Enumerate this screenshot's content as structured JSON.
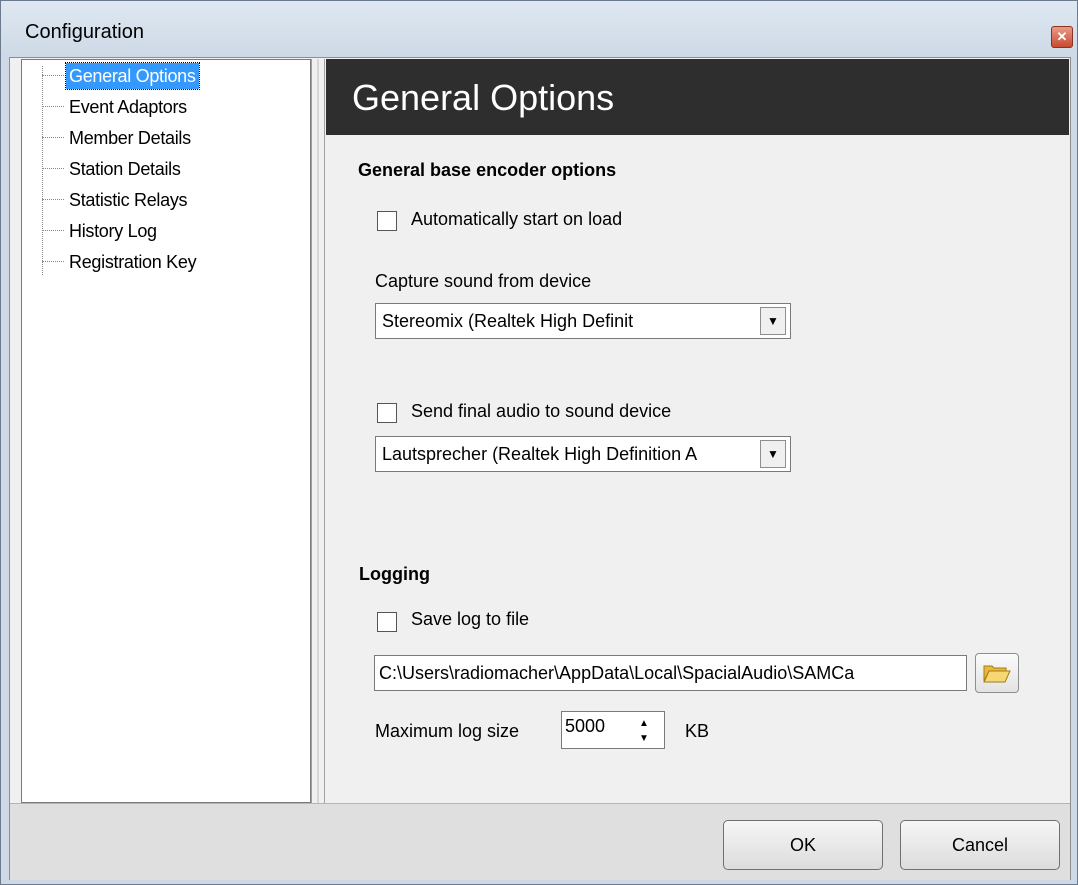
{
  "window": {
    "title": "Configuration"
  },
  "icons": {
    "close": "close-icon",
    "folder": "folder-open-icon",
    "dropdown": "dropdown-arrow-icon"
  },
  "tree": {
    "items": [
      {
        "label": "General Options",
        "selected": true
      },
      {
        "label": "Event Adaptors",
        "selected": false
      },
      {
        "label": "Member Details",
        "selected": false
      },
      {
        "label": "Station Details",
        "selected": false
      },
      {
        "label": "Statistic Relays",
        "selected": false
      },
      {
        "label": "History Log",
        "selected": false
      },
      {
        "label": "Registration Key",
        "selected": false
      }
    ]
  },
  "header": {
    "title": "General Options"
  },
  "encoder": {
    "heading": "General base encoder options",
    "autostart": {
      "label": "Automatically start on load",
      "checked": false
    },
    "capture": {
      "label": "Capture sound from device",
      "value": "Stereomix (Realtek High Definit"
    },
    "send_final": {
      "label": "Send final audio to sound device",
      "checked": false
    },
    "output_device": {
      "value": "Lautsprecher (Realtek High Definition A"
    }
  },
  "logging": {
    "heading": "Logging",
    "save_log": {
      "label": "Save log to file",
      "checked": false
    },
    "path": "C:\\Users\\radiomacher\\AppData\\Local\\SpacialAudio\\SAMCa",
    "max_size_label": "Maximum log size",
    "max_size_value": "5000",
    "unit": "KB"
  },
  "buttons": {
    "ok": "OK",
    "cancel": "Cancel"
  }
}
